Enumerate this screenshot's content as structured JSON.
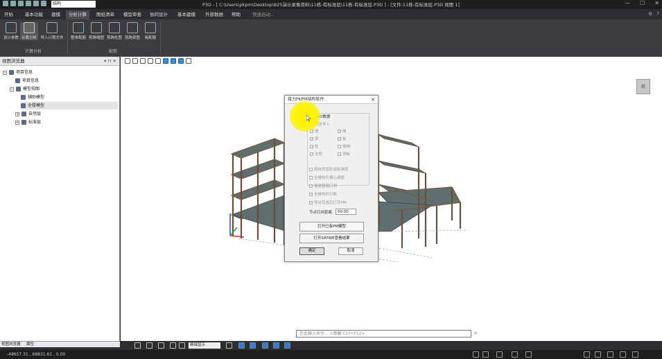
{
  "titlebar": {
    "combo_value": "结构",
    "title": "P3D - [ C:\\Users\\pkpm\\Desktop\\825演示录像资料\\11栋-有标准层\\11栋-有标准层.P3D ] - [文件:11栋-有标准层.P3D 视图 1]",
    "winbtns": [
      "—",
      "☐",
      "✕"
    ]
  },
  "menubar": {
    "tabs": [
      "开始",
      "基本功能",
      "建模",
      "分析计算",
      "图纸清单",
      "模型审查",
      "协同设计",
      "基本建模",
      "外部数据",
      "帮助"
    ],
    "active_tab": "分析计算",
    "search_hint": "快速启动...",
    "right_icons": [
      "⚙",
      "?"
    ]
  },
  "ribbon": {
    "buttons": [
      "设计参数",
      "计算分析",
      "导入计算文件",
      "整体配筋",
      "剪跨墙图",
      "剪跨柱图",
      "剪跨梁图",
      "板配筋"
    ],
    "groups": [
      "计算分析",
      "配筋"
    ]
  },
  "panel": {
    "title": "视图浏览器",
    "head_btns": "▾ ⊓ ✕",
    "tree": [
      "项目信息",
      "项目信息",
      "模型视图",
      "辅助模型",
      "全楼模型",
      "自然层",
      "标准层"
    ],
    "tabs": [
      "视图浏览器",
      "属性"
    ]
  },
  "viewcube": {
    "label": "前"
  },
  "dialog": {
    "title": "接力PKPM结构软件",
    "section_title": "iCAD数据",
    "subsection": "完全导入",
    "checkboxes_left": [
      "墙",
      "梁",
      "柱",
      "支撑"
    ],
    "checkboxes_right": [
      "墙",
      "板",
      "楼梯",
      "洞板"
    ],
    "options": [
      "按自然层形成标准层",
      "全楼构件偏心调整",
      "墙梁替墙口洞",
      "全楼构件打断",
      "导出完成后打开PM"
    ],
    "field_label": "节点归并距离",
    "field_value": "50.00",
    "btn_open_pm": "打开已有PM模型",
    "btn_open_satwe": "打开SATWE查看结果",
    "btn_ok": "确定",
    "btn_cancel": "取消",
    "close": "✕"
  },
  "commandline": {
    "placeholder": "在此输入命令... <隐藏:Ctrl+F12>",
    "close": "✕"
  },
  "bottombar": {
    "display_mode": "精细显示"
  },
  "statusbar": {
    "coords": "-48657.31 , 68831.61 , 0.00"
  }
}
